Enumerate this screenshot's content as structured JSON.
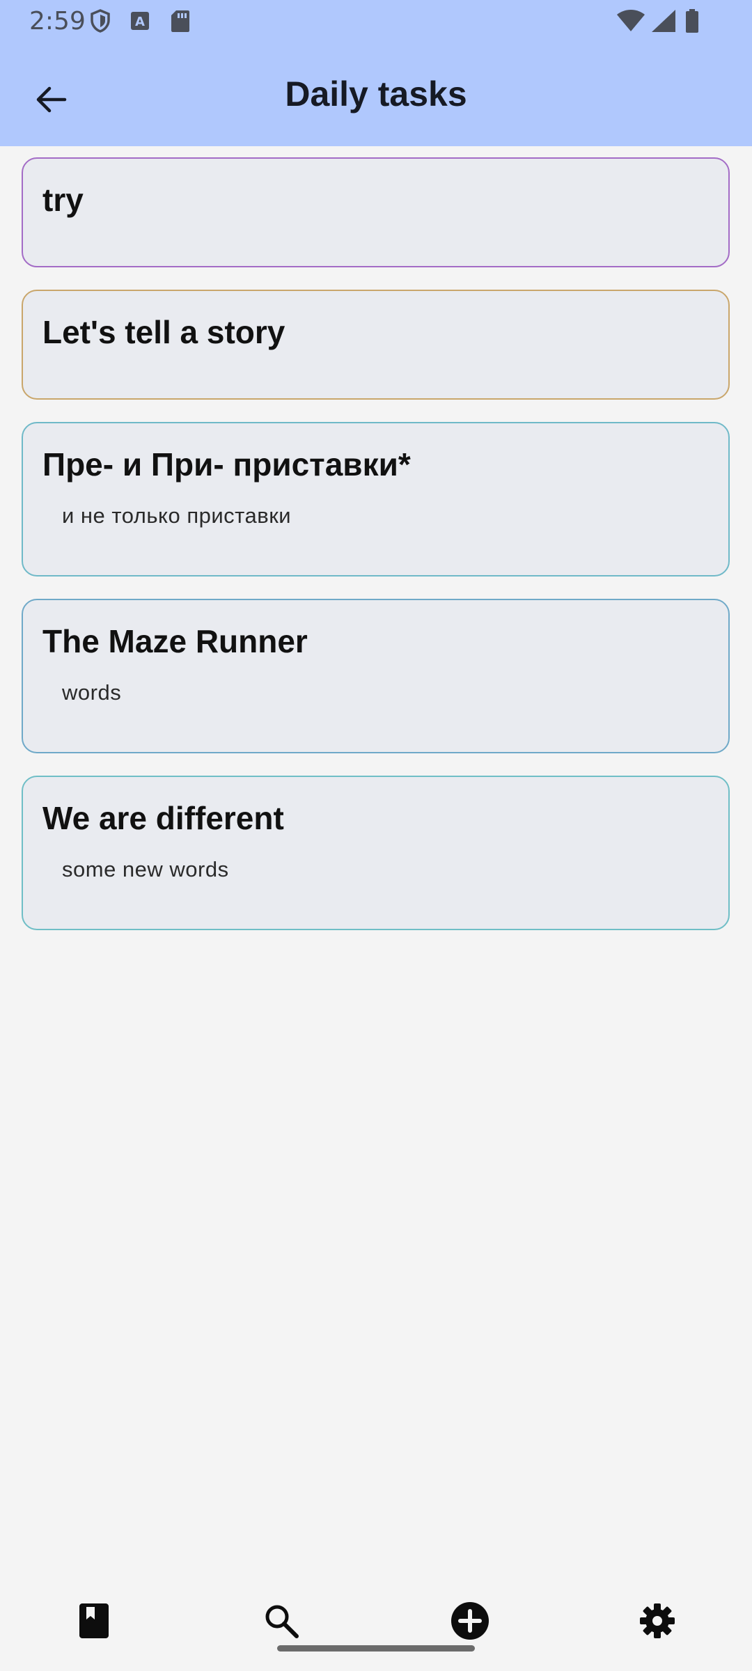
{
  "status_bar": {
    "time": "2:59",
    "left_icons": [
      "shield-icon",
      "text-a-icon",
      "sd-card-icon"
    ],
    "right_icons": [
      "wifi-icon",
      "signal-icon",
      "battery-icon"
    ]
  },
  "app_bar": {
    "title": "Daily tasks",
    "back_icon": "arrow-left-icon"
  },
  "tasks": [
    {
      "title": "try",
      "subtitle": "",
      "border_color": "#a36cc6"
    },
    {
      "title": "Let's tell a story",
      "subtitle": "",
      "border_color": "#c9a66b"
    },
    {
      "title": "Пре- и При- приставки*",
      "subtitle": "и не только приставки",
      "border_color": "#6fb9c8"
    },
    {
      "title": "The Maze Runner",
      "subtitle": "words",
      "border_color": "#6fa9c8"
    },
    {
      "title": "We are different",
      "subtitle": "some new words",
      "border_color": "#6fbec6"
    }
  ],
  "bottom_nav": {
    "items": [
      "book-icon",
      "search-icon",
      "add-circle-icon",
      "settings-icon"
    ]
  },
  "colors": {
    "app_bar_bg": "#b0c8fd",
    "page_bg": "#f4f4f4",
    "card_bg": "#e9ebf0"
  }
}
